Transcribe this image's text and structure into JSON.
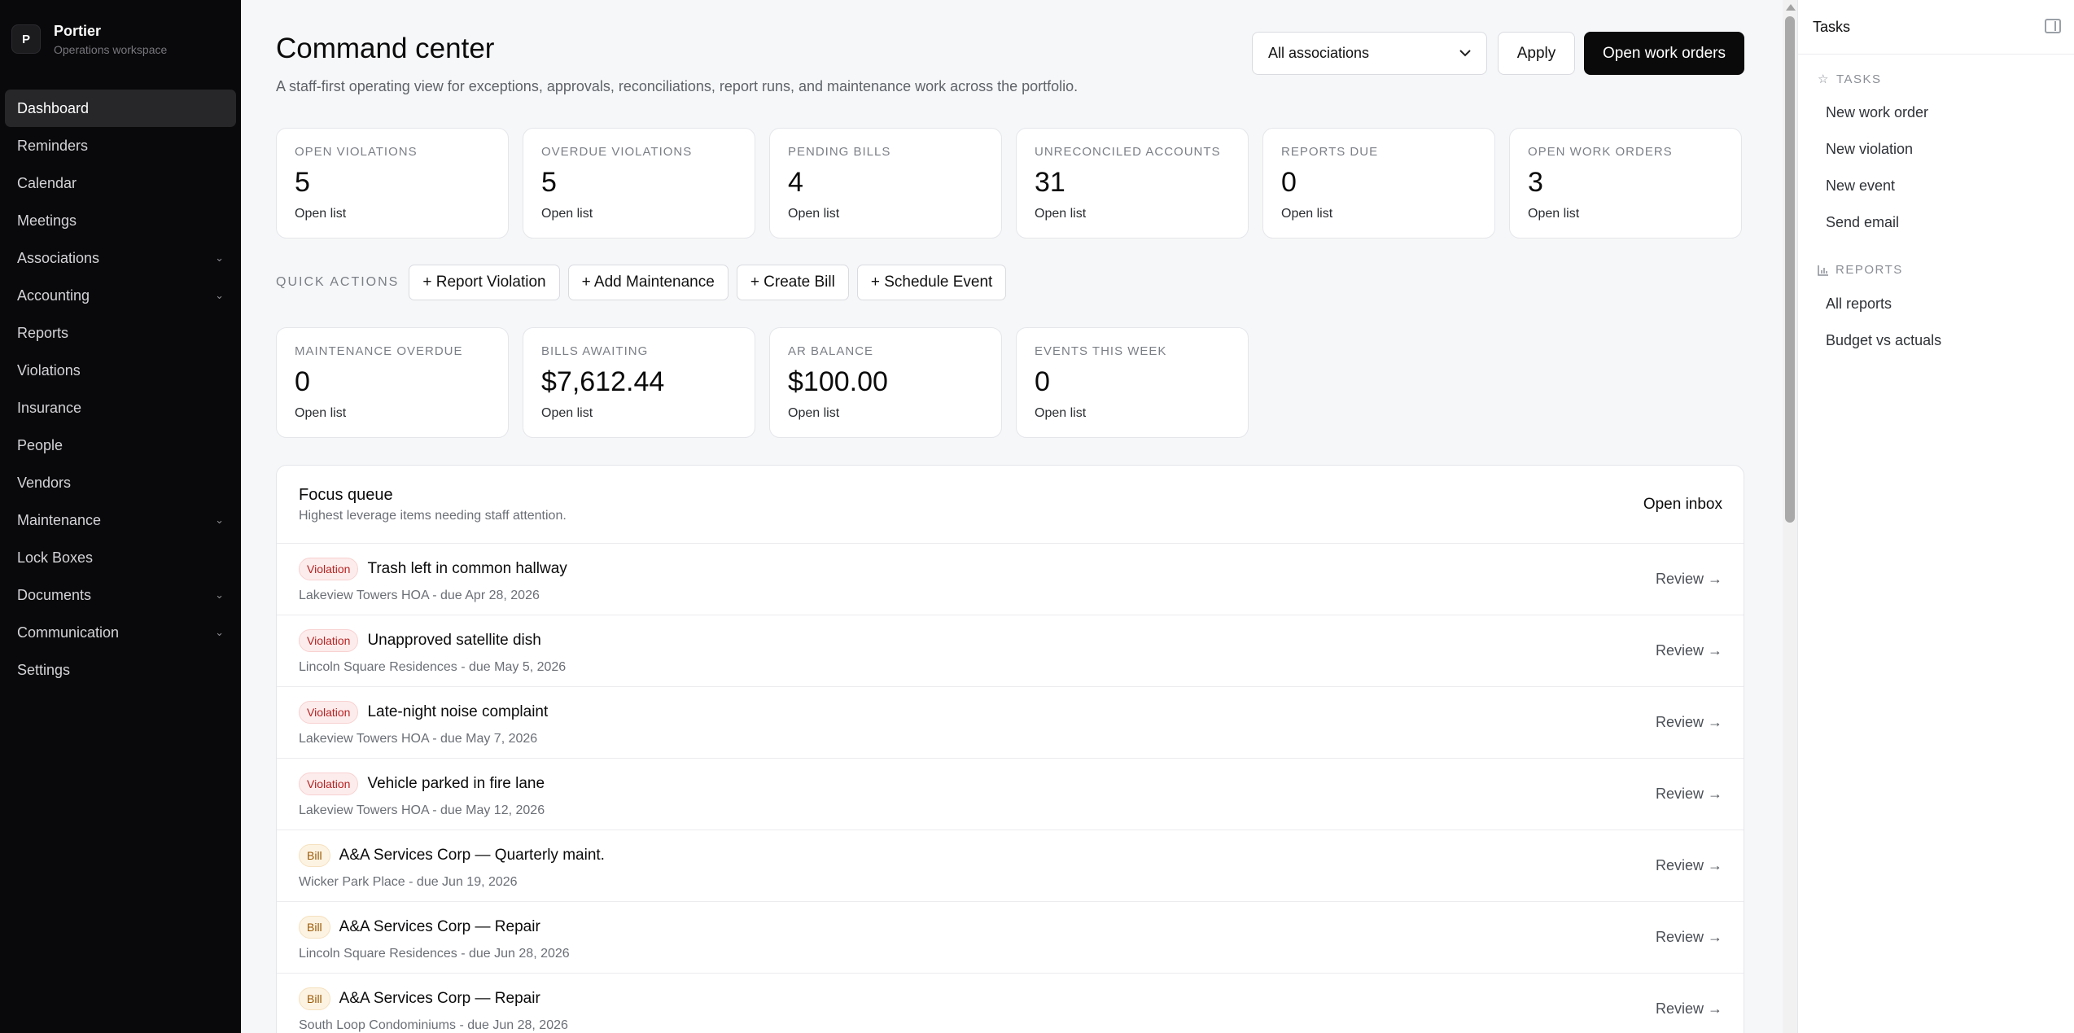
{
  "brand": {
    "logo_letter": "P",
    "name": "Portier",
    "subtitle": "Operations workspace"
  },
  "sidebar": {
    "items": [
      {
        "label": "Dashboard",
        "active": true,
        "has_chevron": false
      },
      {
        "label": "Reminders",
        "has_chevron": false
      },
      {
        "label": "Calendar",
        "has_chevron": false
      },
      {
        "label": "Meetings",
        "has_chevron": false
      },
      {
        "label": "Associations",
        "has_chevron": true
      },
      {
        "label": "Accounting",
        "has_chevron": true
      },
      {
        "label": "Reports",
        "has_chevron": false
      },
      {
        "label": "Violations",
        "has_chevron": false
      },
      {
        "label": "Insurance",
        "has_chevron": false
      },
      {
        "label": "People",
        "has_chevron": false
      },
      {
        "label": "Vendors",
        "has_chevron": false
      },
      {
        "label": "Maintenance",
        "has_chevron": true
      },
      {
        "label": "Lock Boxes",
        "has_chevron": false
      },
      {
        "label": "Documents",
        "has_chevron": true
      },
      {
        "label": "Communication",
        "has_chevron": true
      },
      {
        "label": "Settings",
        "has_chevron": false
      }
    ]
  },
  "header": {
    "title": "Command center",
    "subtitle": "A staff-first operating view for exceptions, approvals, reconciliations, report runs, and maintenance work across the portfolio.",
    "filter_value": "All associations",
    "apply_label": "Apply",
    "primary_label": "Open work orders"
  },
  "stats_row1": [
    {
      "label": "OPEN VIOLATIONS",
      "value": "5",
      "link": "Open list"
    },
    {
      "label": "OVERDUE VIOLATIONS",
      "value": "5",
      "link": "Open list"
    },
    {
      "label": "PENDING BILLS",
      "value": "4",
      "link": "Open list"
    },
    {
      "label": "UNRECONCILED ACCOUNTS",
      "value": "31",
      "link": "Open list"
    },
    {
      "label": "REPORTS DUE",
      "value": "0",
      "link": "Open list"
    },
    {
      "label": "OPEN WORK ORDERS",
      "value": "3",
      "link": "Open list"
    }
  ],
  "quick_actions": {
    "label": "QUICK ACTIONS",
    "buttons": [
      "+ Report Violation",
      "+ Add Maintenance",
      "+ Create Bill",
      "+ Schedule Event"
    ]
  },
  "stats_row2": [
    {
      "label": "MAINTENANCE OVERDUE",
      "value": "0",
      "link": "Open list"
    },
    {
      "label": "BILLS AWAITING",
      "value": "$7,612.44",
      "link": "Open list"
    },
    {
      "label": "AR BALANCE",
      "value": "$100.00",
      "link": "Open list"
    },
    {
      "label": "EVENTS THIS WEEK",
      "value": "0",
      "link": "Open list"
    }
  ],
  "focus_queue": {
    "title": "Focus queue",
    "subtitle": "Highest leverage items needing staff attention.",
    "open_label": "Open inbox",
    "review_label": "Review →",
    "items": [
      {
        "badge": "Violation",
        "type": "violation",
        "title": "Trash left in common hallway",
        "meta": "Lakeview Towers HOA - due Apr 28, 2026"
      },
      {
        "badge": "Violation",
        "type": "violation",
        "title": "Unapproved satellite dish",
        "meta": "Lincoln Square Residences - due May 5, 2026"
      },
      {
        "badge": "Violation",
        "type": "violation",
        "title": "Late-night noise complaint",
        "meta": "Lakeview Towers HOA - due May 7, 2026"
      },
      {
        "badge": "Violation",
        "type": "violation",
        "title": "Vehicle parked in fire lane",
        "meta": "Lakeview Towers HOA - due May 12, 2026"
      },
      {
        "badge": "Bill",
        "type": "bill",
        "title": "A&A Services Corp — Quarterly maint.",
        "meta": "Wicker Park Place - due Jun 19, 2026"
      },
      {
        "badge": "Bill",
        "type": "bill",
        "title": "A&A Services Corp — Repair",
        "meta": "Lincoln Square Residences - due Jun 28, 2026"
      },
      {
        "badge": "Bill",
        "type": "bill",
        "title": "A&A Services Corp — Repair",
        "meta": "South Loop Condominiums - due Jun 28, 2026"
      }
    ]
  },
  "right_panel": {
    "title": "Tasks",
    "tasks_label": "TASKS",
    "tasks": [
      "New work order",
      "New violation",
      "New event",
      "Send email"
    ],
    "reports_label": "REPORTS",
    "reports": [
      "All reports",
      "Budget vs actuals"
    ]
  },
  "colors": {
    "sidebar_bg": "#09090b",
    "primary_button": "#0a0a0b",
    "violation_badge": "#b42323",
    "bill_badge": "#9a5a06"
  },
  "icons": {
    "select": "chevron-down-icon",
    "tasks": "star-icon",
    "reports": "bar-chart-icon",
    "panel_toggle": "panel-collapse-icon"
  }
}
